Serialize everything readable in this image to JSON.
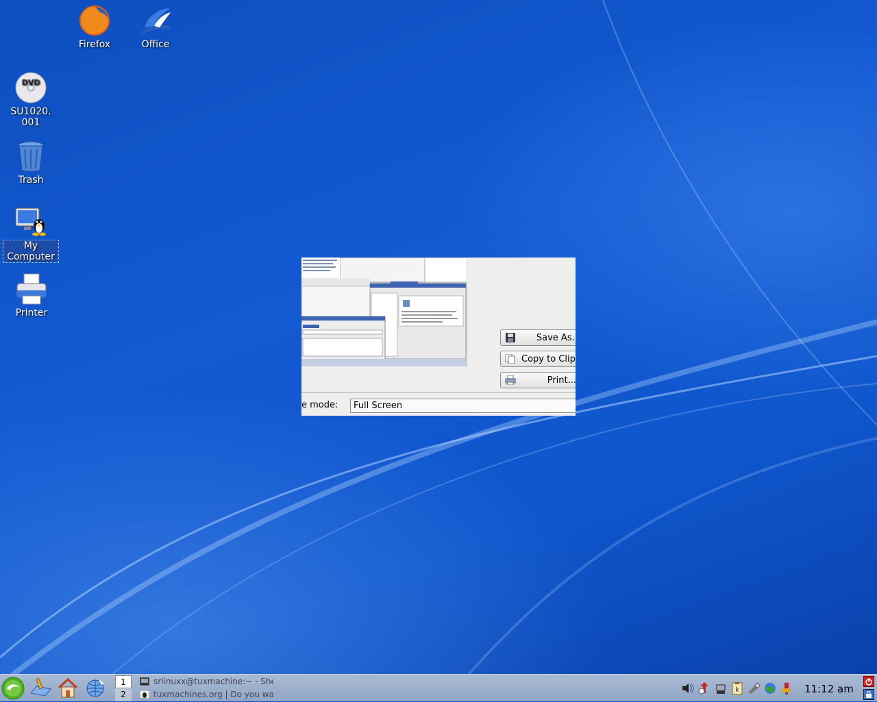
{
  "desktop": {
    "icons": [
      {
        "label": "Firefox",
        "icon": "firefox-icon"
      },
      {
        "label": "Office",
        "icon": "office-icon"
      },
      {
        "label": "SU1020.\n001",
        "icon": "dvd-icon"
      },
      {
        "label": "Trash",
        "icon": "trash-icon"
      },
      {
        "label": "My\nComputer",
        "icon": "my-computer-icon"
      },
      {
        "label": "Printer",
        "icon": "printer-icon"
      }
    ]
  },
  "snapshot_dialog": {
    "buttons": {
      "save_as": "Save As...",
      "copy_to_clipboard": "Copy to Clipboard",
      "print": "Print..."
    },
    "capture_mode_label": "e mode:",
    "capture_mode_value": "Full Screen"
  },
  "taskbar": {
    "pager": [
      "1",
      "2"
    ],
    "tasks": [
      {
        "label": "srlinuxx@tuxmachine:~ - Shell -",
        "icon": "terminal-icon"
      },
      {
        "label": "tuxmachines.org | Do you wadd",
        "icon": "tux-icon"
      }
    ],
    "tray_icons": [
      "speaker-icon",
      "update-icon",
      "network-manager-icon",
      "klipper-icon",
      "connection-icon",
      "globe-icon",
      "usb-icon"
    ],
    "clock": "11:12 am"
  },
  "colors": {
    "desktop": "#1359d2",
    "taskbar": "#a0b3ce",
    "dialog": "#eeeeec"
  }
}
